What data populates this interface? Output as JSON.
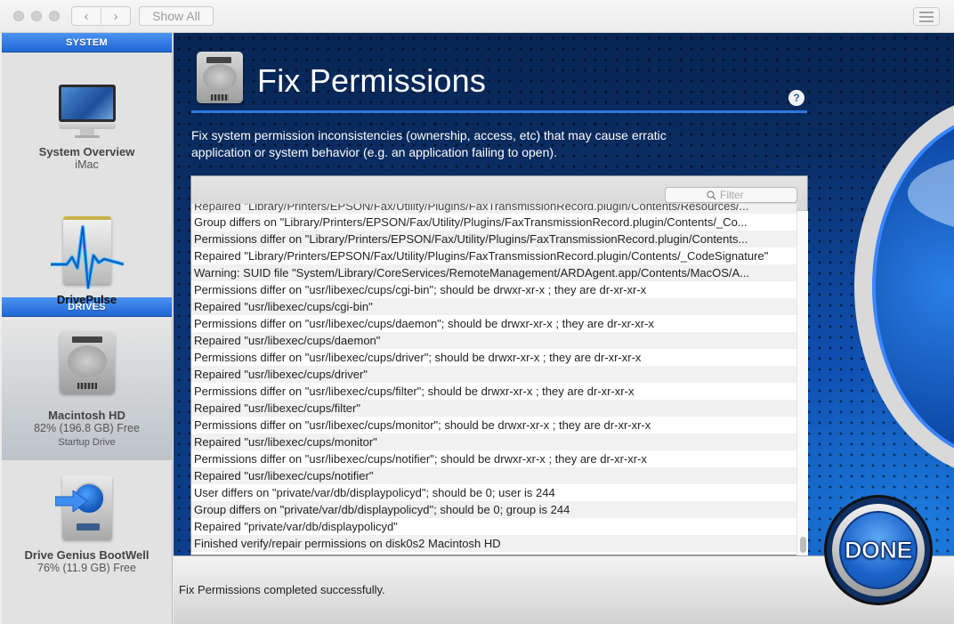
{
  "titlebar": {
    "back_icon": "chevron-left-icon",
    "forward_icon": "chevron-right-icon",
    "back_glyph": "‹",
    "forward_glyph": "›",
    "show_all_label": "Show All",
    "list_icon": "list-view-icon"
  },
  "sidebar": {
    "system_header": "SYSTEM",
    "system_items": [
      {
        "title": "System Overview",
        "subtitle": "iMac",
        "icon": "imac-icon"
      },
      {
        "title": "DrivePulse",
        "icon": "drivepulse-icon"
      }
    ],
    "drives_header": "DRIVES",
    "drive_items": [
      {
        "title": "Macintosh HD",
        "subtitle": "82% (196.8 GB) Free",
        "detail": "Startup Drive",
        "icon": "hard-drive-icon",
        "selected": true
      },
      {
        "title": "Drive Genius BootWell",
        "subtitle": "76% (11.9 GB) Free",
        "icon": "bootwell-drive-icon"
      }
    ]
  },
  "main": {
    "icon": "hard-drive-icon",
    "title": "Fix Permissions",
    "help_label": "?",
    "description": "Fix system permission inconsistencies (ownership, access, etc) that may cause erratic application or system behavior (e.g. an application failing to open).",
    "filter": {
      "placeholder": "Filter",
      "icon": "search-icon"
    },
    "log_lines": [
      "Repaired \"Library/Printers/EPSON/Fax/Utility/Plugins/FaxTransmissionRecord.plugin/Contents/Resources/...",
      "Group differs on \"Library/Printers/EPSON/Fax/Utility/Plugins/FaxTransmissionRecord.plugin/Contents/_Co...",
      "Permissions differ on \"Library/Printers/EPSON/Fax/Utility/Plugins/FaxTransmissionRecord.plugin/Contents...",
      "Repaired \"Library/Printers/EPSON/Fax/Utility/Plugins/FaxTransmissionRecord.plugin/Contents/_CodeSignature\"",
      "Warning: SUID file \"System/Library/CoreServices/RemoteManagement/ARDAgent.app/Contents/MacOS/A...",
      "Permissions differ on \"usr/libexec/cups/cgi-bin\"; should be drwxr-xr-x ; they are dr-xr-xr-x",
      "Repaired \"usr/libexec/cups/cgi-bin\"",
      "Permissions differ on \"usr/libexec/cups/daemon\"; should be drwxr-xr-x ; they are dr-xr-xr-x",
      "Repaired \"usr/libexec/cups/daemon\"",
      "Permissions differ on \"usr/libexec/cups/driver\"; should be drwxr-xr-x ; they are dr-xr-xr-x",
      "Repaired \"usr/libexec/cups/driver\"",
      "Permissions differ on \"usr/libexec/cups/filter\"; should be drwxr-xr-x ; they are dr-xr-xr-x",
      "Repaired \"usr/libexec/cups/filter\"",
      "Permissions differ on \"usr/libexec/cups/monitor\"; should be drwxr-xr-x ; they are dr-xr-xr-x",
      "Repaired \"usr/libexec/cups/monitor\"",
      "Permissions differ on \"usr/libexec/cups/notifier\"; should be drwxr-xr-x ; they are dr-xr-xr-x",
      "Repaired \"usr/libexec/cups/notifier\"",
      "User differs on \"private/var/db/displaypolicyd\"; should be 0; user is 244",
      "Group differs on \"private/var/db/displaypolicyd\"; should be 0; group is 244",
      "Repaired \"private/var/db/displaypolicyd\"",
      "Finished verify/repair permissions on disk0s2 Macintosh HD"
    ]
  },
  "status": {
    "message": "Fix Permissions completed successfully."
  },
  "done_button": {
    "label": "DONE"
  },
  "colors": {
    "accent_blue": "#1f66d6",
    "panel_navy": "#0b2e68",
    "rule_blue": "#2e78e0"
  }
}
